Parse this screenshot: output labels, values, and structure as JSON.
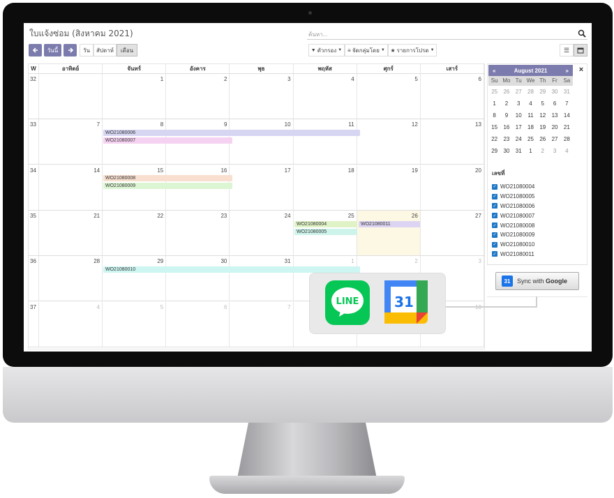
{
  "header": {
    "title": "ใบแจ้งซ่อม (สิงหาคม 2021)",
    "search_placeholder": "ค้นหา..."
  },
  "toolbar": {
    "today_label": "วันนี้",
    "view_day": "วัน",
    "view_week": "สัปดาห์",
    "view_month": "เดือน",
    "filters_label": "ตัวกรอง",
    "groupby_label": "จัดกลุ่มโดย",
    "favorites_label": "รายการโปรด"
  },
  "calendar": {
    "week_header": "W",
    "day_headers": [
      "อาทิตย์",
      "จันทร์",
      "อังคาร",
      "พุธ",
      "พฤหัส",
      "ศุกร์",
      "เสาร์"
    ],
    "weeks": [
      {
        "w": "32",
        "days": [
          "",
          "1",
          "2",
          "3",
          "4",
          "5",
          "6"
        ]
      },
      {
        "w": "33",
        "days": [
          "7",
          "8",
          "9",
          "10",
          "11",
          "12",
          "13"
        ]
      },
      {
        "w": "34",
        "days": [
          "14",
          "15",
          "16",
          "17",
          "18",
          "19",
          "20"
        ]
      },
      {
        "w": "35",
        "days": [
          "21",
          "22",
          "23",
          "24",
          "25",
          "26",
          "27"
        ]
      },
      {
        "w": "36",
        "days": [
          "28",
          "29",
          "30",
          "31",
          "1",
          "2",
          "3"
        ]
      },
      {
        "w": "37",
        "days": [
          "4",
          "5",
          "6",
          "7",
          "8",
          "9",
          "10"
        ]
      }
    ],
    "events": [
      {
        "label": "WO21080006",
        "color": "#d6d6f3"
      },
      {
        "label": "WO21080007",
        "color": "#f6d2f2"
      },
      {
        "label": "WO21080008",
        "color": "#f8dfcf"
      },
      {
        "label": "WO21080009",
        "color": "#dcf5d3"
      },
      {
        "label": "WO21080004",
        "color": "#e0f3c6"
      },
      {
        "label": "WO21080005",
        "color": "#cdf3ea"
      },
      {
        "label": "WO21080011",
        "color": "#dcd4f2"
      },
      {
        "label": "WO21080010",
        "color": "#cdf5f1"
      }
    ]
  },
  "sidebar": {
    "month_title": "August 2021",
    "prev": "«",
    "next": "»",
    "close": "×",
    "day_names": [
      "Su",
      "Mo",
      "Tu",
      "We",
      "Th",
      "Fr",
      "Sa"
    ],
    "mini_days": [
      "25",
      "26",
      "27",
      "28",
      "29",
      "30",
      "31",
      "1",
      "2",
      "3",
      "4",
      "5",
      "6",
      "7",
      "8",
      "9",
      "10",
      "11",
      "12",
      "13",
      "14",
      "15",
      "16",
      "17",
      "18",
      "19",
      "20",
      "21",
      "22",
      "23",
      "24",
      "25",
      "26",
      "27",
      "28",
      "29",
      "30",
      "31",
      "1",
      "2",
      "3",
      "4"
    ],
    "filter_label": "เลขที่",
    "filter_items": [
      "WO21080004",
      "WO21080005",
      "WO21080006",
      "WO21080007",
      "WO21080008",
      "WO21080009",
      "WO21080010",
      "WO21080011"
    ],
    "sync_label": "Sync with",
    "sync_brand": "Google",
    "gcal_mini": "31"
  },
  "apps": {
    "line_label": "LINE",
    "gcal_number": "31"
  }
}
